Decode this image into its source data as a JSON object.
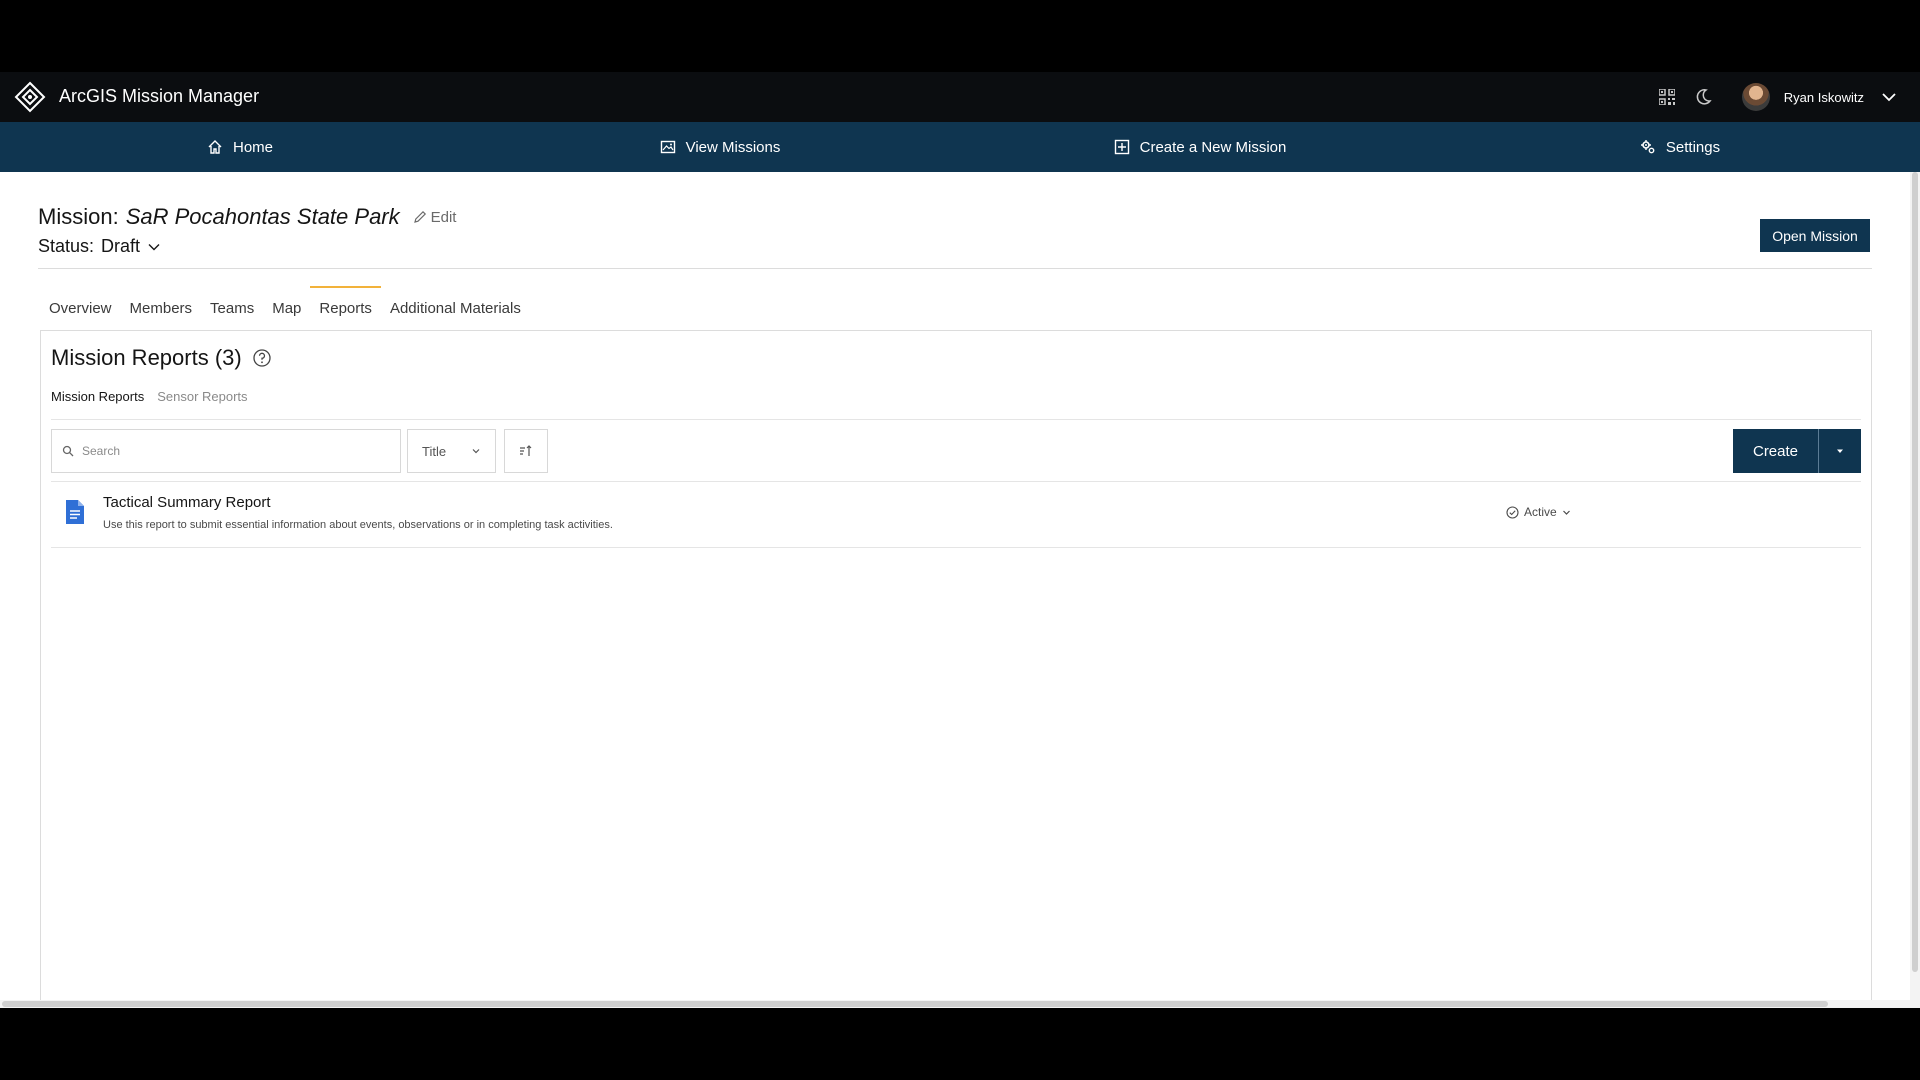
{
  "header": {
    "app_title": "ArcGIS Mission Manager",
    "user_name": "Ryan Iskowitz"
  },
  "nav": {
    "items": [
      {
        "label": "Home",
        "icon": "home-icon"
      },
      {
        "label": "View Missions",
        "icon": "image-icon"
      },
      {
        "label": "Create a New Mission",
        "icon": "plus-square-icon"
      },
      {
        "label": "Settings",
        "icon": "gear-icon"
      }
    ]
  },
  "mission": {
    "prefix": "Mission:",
    "name": "SaR Pocahontas State Park",
    "edit_label": "Edit",
    "status_label": "Status:",
    "status_value": "Draft",
    "open_button": "Open Mission"
  },
  "tabs": [
    {
      "label": "Overview"
    },
    {
      "label": "Members"
    },
    {
      "label": "Teams"
    },
    {
      "label": "Map"
    },
    {
      "label": "Reports"
    },
    {
      "label": "Additional Materials"
    }
  ],
  "reports": {
    "title": "Mission Reports (3)",
    "subtabs": [
      "Mission Reports",
      "Sensor Reports"
    ],
    "search_placeholder": "Search",
    "sort_field": "Title",
    "create_label": "Create",
    "items": [
      {
        "title": "Tactical Summary Report",
        "description": "Use this report to submit essential information about events, observations or in completing task activities.",
        "status": "Active"
      }
    ]
  },
  "colors": {
    "topbar": "#0b0d10",
    "navbar": "#0f3550",
    "primary_button": "#0f3550",
    "active_tab_indicator": "#f2b23a",
    "report_icon": "#2f6fd6"
  }
}
